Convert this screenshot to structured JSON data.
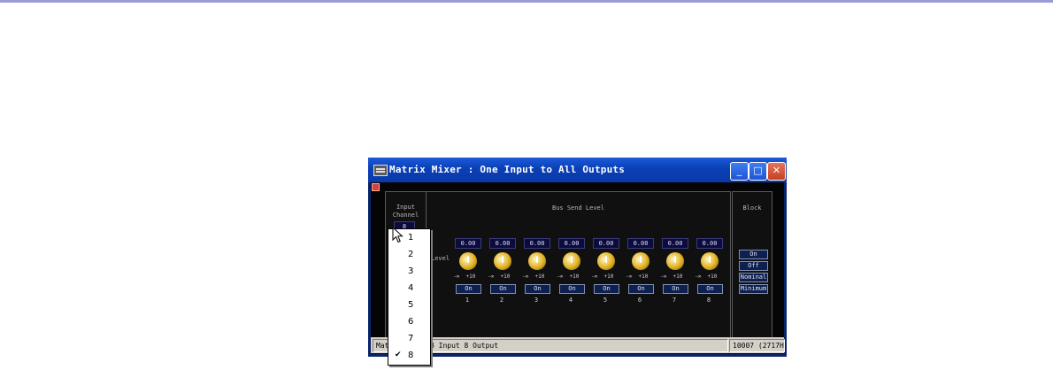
{
  "window": {
    "title": "Matrix Mixer : One Input to All Outputs",
    "buttons": [
      "minimize",
      "maximize",
      "close"
    ]
  },
  "input_panel": {
    "label_line1": "Input",
    "label_line2": "Channel",
    "selected_value": "8"
  },
  "bus_panel": {
    "title": "Bus Send Level",
    "row_label": "Level",
    "scale_min": "-∞",
    "scale_max": "+10",
    "channels": [
      {
        "number": "1",
        "value": "0.00",
        "button": "On"
      },
      {
        "number": "2",
        "value": "0.00",
        "button": "On"
      },
      {
        "number": "3",
        "value": "0.00",
        "button": "On"
      },
      {
        "number": "4",
        "value": "0.00",
        "button": "On"
      },
      {
        "number": "5",
        "value": "0.00",
        "button": "On"
      },
      {
        "number": "6",
        "value": "0.00",
        "button": "On"
      },
      {
        "number": "7",
        "value": "0.00",
        "button": "On"
      },
      {
        "number": "8",
        "value": "0.00",
        "button": "On"
      }
    ]
  },
  "block_panel": {
    "title": "Block",
    "buttons": [
      "On",
      "Off",
      "Nominal",
      "Minimum"
    ]
  },
  "status": {
    "left_prefix": "Matr",
    "left_suffix": "8 Input 8 Output",
    "right": "10007 (2717H)"
  },
  "dropdown": {
    "items": [
      "1",
      "2",
      "3",
      "4",
      "5",
      "6",
      "7",
      "8"
    ],
    "checked": "8"
  },
  "icons": {
    "app": "matrix-app-icon",
    "check": "checkmark-icon",
    "pointer": "mouse-pointer-icon"
  }
}
